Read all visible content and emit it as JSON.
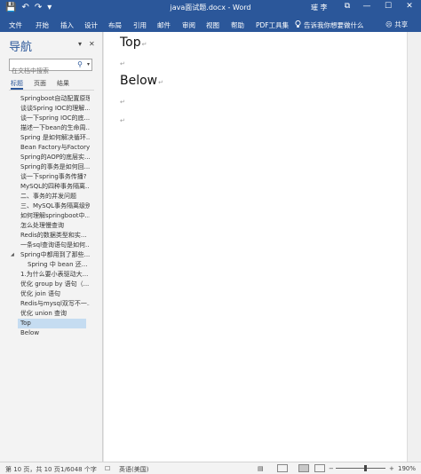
{
  "window": {
    "title": "java面试题.docx  -  Word",
    "user": "璀 李",
    "controls": {
      "restore_ribbon": "⧉",
      "minimize": "—",
      "maximize": "☐",
      "close": "✕"
    }
  },
  "quick_access": {
    "save": "💾",
    "undo": "↶",
    "redo": "↷",
    "customize": "▾"
  },
  "ribbon": {
    "tabs": [
      "文件",
      "开始",
      "插入",
      "设计",
      "布局",
      "引用",
      "邮件",
      "审阅",
      "视图",
      "帮助",
      "PDF工具集"
    ],
    "tell_me": "告诉我你想要做什么",
    "share": "共享"
  },
  "nav_pane": {
    "title": "导航",
    "options": "▾",
    "close": "✕",
    "search": {
      "placeholder": "在文档中搜索",
      "icon": "⚲",
      "dropdown": "▾"
    },
    "tabs": [
      "标题",
      "页面",
      "结果"
    ],
    "collapse_arrow": "◢",
    "headings": [
      {
        "text": "Springboot自动配置原理"
      },
      {
        "text": "谈谈Spring IOC的理解..."
      },
      {
        "text": "谈一下spring IOC的底..."
      },
      {
        "text": "描述一下bean的生命周..."
      },
      {
        "text": "Spring 是如何解决循环..."
      },
      {
        "text": "Bean Factory与Factory..."
      },
      {
        "text": "Spring的AOP的底层实..."
      },
      {
        "text": "Spring的事务是如何回..."
      },
      {
        "text": "谈一下spring事务传播?"
      },
      {
        "text": "MySQL的四种事务隔离..."
      },
      {
        "text": "二、事务的并发问题"
      },
      {
        "text": "三、MySQL事务隔离级别"
      },
      {
        "text": "如何理解springboot中..."
      },
      {
        "text": "怎么处理慢查询"
      },
      {
        "text": "Redis的数据类型和实..."
      },
      {
        "text": "一条sql查询语句是如何..."
      },
      {
        "text": "Spring中都用到了那些..."
      },
      {
        "text": "Spring 中 bean 还..."
      },
      {
        "text": "1.为什么要小表驱动大..."
      },
      {
        "text": "优化 group by 语句（..."
      },
      {
        "text": "优化 join 语句"
      },
      {
        "text": "Redis与mysql双写不一..."
      },
      {
        "text": "优化 union 查询"
      },
      {
        "text": "Top"
      },
      {
        "text": "Below"
      }
    ]
  },
  "document": {
    "heading_top": "Top",
    "heading_below": "Below",
    "para_mark": "↵"
  },
  "statusbar": {
    "page": "第 10 页，共 10 页",
    "words": "1/6048 个字",
    "proofing_icon": "☐",
    "language": "英语(美国)",
    "focus_icon": "▤",
    "zoom_out": "−",
    "zoom_in": "+",
    "zoom": "190%"
  },
  "colors": {
    "accent": "#2b579a",
    "selected": "#c5dcf1"
  }
}
